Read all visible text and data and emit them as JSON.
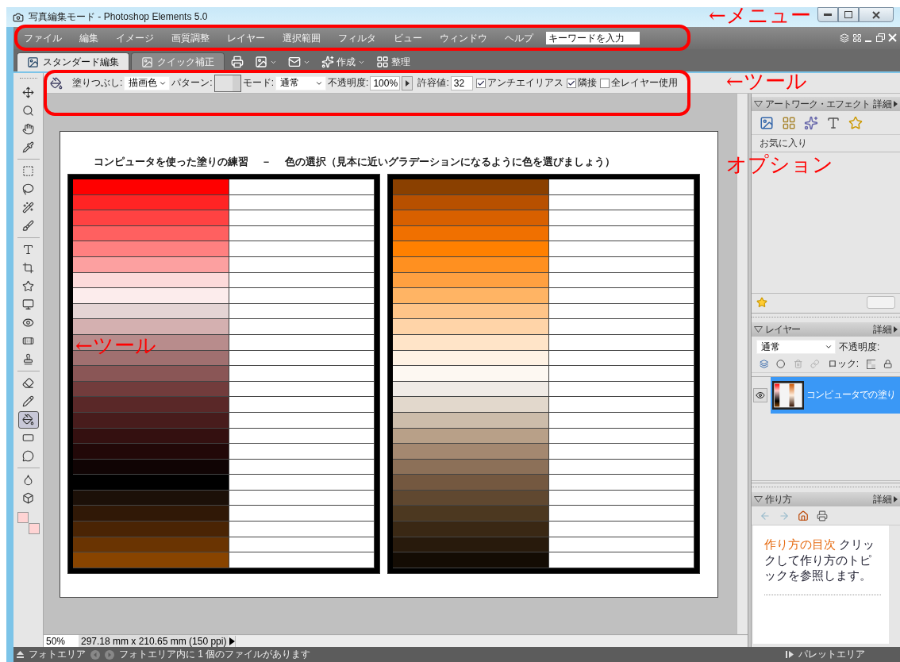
{
  "window": {
    "title": "写真編集モード - Photoshop Elements 5.0"
  },
  "menu": {
    "items": [
      "ファイル",
      "編集",
      "イメージ",
      "画質調整",
      "レイヤー",
      "選択範囲",
      "フィルタ",
      "ビュー",
      "ウィンドウ",
      "ヘルプ"
    ],
    "search": {
      "placeholder": "キーワードを入力"
    }
  },
  "mode_tabs": [
    {
      "label": "スタンダード編集",
      "selected": true
    },
    {
      "label": "クイック補正",
      "selected": false
    }
  ],
  "toolbar_buttons": [
    {
      "kind": "print",
      "menu": false
    },
    {
      "kind": "photo",
      "menu": true
    },
    {
      "kind": "mail",
      "menu": true
    },
    {
      "kind": "create",
      "label": "作成",
      "menu": true
    },
    {
      "kind": "organize",
      "label": "整理",
      "menu": false
    }
  ],
  "tool_options": {
    "fill_label": "塗りつぶし:",
    "fill_value": "描画色",
    "pattern_label": "パターン:",
    "mode_label": "モード:",
    "mode_value": "通常",
    "opacity_label": "不透明度:",
    "opacity_value": "100%",
    "tolerance_label": "許容値:",
    "tolerance_value": "32",
    "checkboxes": [
      {
        "label": "アンチエイリアス",
        "checked": true
      },
      {
        "label": "隣接",
        "checked": true
      },
      {
        "label": "全レイヤー使用",
        "checked": false
      }
    ]
  },
  "tools": [
    {
      "kind": "move",
      "selected": false
    },
    {
      "kind": "zoom",
      "selected": false
    },
    {
      "kind": "hand",
      "selected": false
    },
    {
      "kind": "eyedropper",
      "selected": false
    },
    {
      "kind": "marquee",
      "selected": false
    },
    {
      "kind": "lasso",
      "selected": false
    },
    {
      "kind": "wand",
      "selected": false
    },
    {
      "kind": "brush-select",
      "selected": false
    },
    {
      "kind": "type",
      "selected": false
    },
    {
      "kind": "crop",
      "selected": false
    },
    {
      "kind": "shape",
      "selected": false
    },
    {
      "kind": "recompose",
      "selected": false
    },
    {
      "kind": "redeye",
      "selected": false
    },
    {
      "kind": "heal",
      "selected": false
    },
    {
      "kind": "stamp",
      "selected": false
    },
    {
      "kind": "eraser",
      "selected": false
    },
    {
      "kind": "pencil",
      "selected": false
    },
    {
      "kind": "bucket",
      "selected": true
    },
    {
      "kind": "gradient",
      "selected": false
    },
    {
      "kind": "balloon",
      "selected": false
    },
    {
      "kind": "blur",
      "selected": false
    },
    {
      "kind": "sponge",
      "selected": false
    }
  ],
  "color_chips": [
    {
      "color": "#ffd4d4"
    },
    {
      "color": "#ffd4d4"
    }
  ],
  "document": {
    "title": "コンピュータを使った塗りの練習　 －　 色の選択（見本に近いグラデーションになるように色を選びましょう）",
    "tables": [
      {
        "rows": [
          {
            "color": "#ff0000"
          },
          {
            "color": "#ff2424"
          },
          {
            "color": "#ff4242"
          },
          {
            "color": "#ff6060"
          },
          {
            "color": "#ff8080"
          },
          {
            "color": "#fca0a0"
          },
          {
            "color": "#fcdada"
          },
          {
            "color": "#fcecec"
          },
          {
            "color": "#e4d4d4"
          },
          {
            "color": "#d4b0b0"
          },
          {
            "color": "#b88c8c"
          },
          {
            "color": "#a07070"
          },
          {
            "color": "#8a5656"
          },
          {
            "color": "#723c3c"
          },
          {
            "color": "#5a2828"
          },
          {
            "color": "#481c1c"
          },
          {
            "color": "#341010"
          },
          {
            "color": "#220808"
          },
          {
            "color": "#100404"
          },
          {
            "color": "#000000"
          },
          {
            "color": "#1c1008"
          },
          {
            "color": "#301806"
          },
          {
            "color": "#4a2404"
          },
          {
            "color": "#6a3402"
          },
          {
            "color": "#884400"
          }
        ]
      },
      {
        "rows": [
          {
            "color": "#8a4000"
          },
          {
            "color": "#b85000"
          },
          {
            "color": "#d86000"
          },
          {
            "color": "#f07000"
          },
          {
            "color": "#ff8000"
          },
          {
            "color": "#ff9020"
          },
          {
            "color": "#ffa040"
          },
          {
            "color": "#ffb464"
          },
          {
            "color": "#ffc488"
          },
          {
            "color": "#ffd4a8"
          },
          {
            "color": "#ffe4c8"
          },
          {
            "color": "#fff2e4"
          },
          {
            "color": "#fdf8f2"
          },
          {
            "color": "#f0ebe6"
          },
          {
            "color": "#e2d8cc"
          },
          {
            "color": "#ccbcaa"
          },
          {
            "color": "#b8a088"
          },
          {
            "color": "#a48870"
          },
          {
            "color": "#8c7058"
          },
          {
            "color": "#745840"
          },
          {
            "color": "#604830"
          },
          {
            "color": "#4c3820"
          },
          {
            "color": "#3a2814"
          },
          {
            "color": "#281a0c"
          },
          {
            "color": "#140c04"
          }
        ]
      }
    ]
  },
  "view_status": {
    "zoom": "50%",
    "size": "297.18 mm x 210.65 mm (150 ppi)"
  },
  "panels": {
    "artwork": {
      "title": "アートワーク・エフェクト",
      "more": "詳細",
      "category": "お気に入り"
    },
    "layers": {
      "title": "レイヤー",
      "more": "詳細",
      "blend_mode": "通常",
      "opacity_label": "不透明度:",
      "lock_label": "ロック:",
      "items": [
        {
          "name": "コンピュータでの塗り",
          "selected": true,
          "visible": true
        }
      ]
    },
    "howto": {
      "title": "作り方",
      "more": "詳細",
      "link": "作り方の目次",
      "text": "クリックして作り方のトピックを参照します。"
    }
  },
  "status_bar": {
    "photo_area": "フォトエリア",
    "message": "フォトエリア内に 1 個のファイルがあります",
    "palette_area": "パレットエリア"
  },
  "annotations": [
    {
      "text": "←メニュー"
    },
    {
      "text": "←ツール"
    },
    {
      "text": "オプション"
    },
    {
      "text": "←ツール"
    }
  ]
}
